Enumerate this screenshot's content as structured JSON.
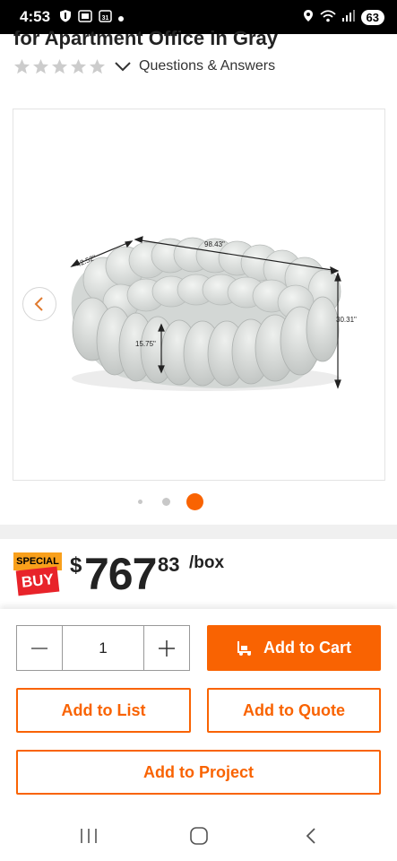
{
  "status_bar": {
    "time": "4:53",
    "battery": "63",
    "network": "6"
  },
  "product": {
    "title_fragment": "for Apartment Office in Gray",
    "rating_stars": 0,
    "questions_link": "Questions & Answers"
  },
  "gallery": {
    "dimensions": {
      "width": "98.43\"",
      "depth": "42.52\"",
      "height": "30.31\"",
      "seat_height": "15.75\""
    },
    "active_dot": 3,
    "dot_count": 3
  },
  "price": {
    "badge_top": "SPECIAL",
    "badge_bottom": "BUY",
    "currency": "$",
    "dollars": "767",
    "cents": "83",
    "unit": "/box"
  },
  "purchase": {
    "quantity": "1",
    "add_to_cart": "Add to Cart",
    "add_to_list": "Add to List",
    "add_to_quote": "Add to Quote",
    "add_to_project": "Add to Project"
  },
  "colors": {
    "accent": "#f96302",
    "badge_yellow": "#f9a01b",
    "badge_red": "#e8232a"
  },
  "icons": [
    "shield-icon",
    "screen-cast-icon",
    "calendar-icon",
    "location-icon",
    "wifi-icon",
    "signal-icon",
    "chevron-down-icon",
    "chevron-left-icon",
    "forklift-icon",
    "recent-apps-icon",
    "home-icon",
    "back-icon"
  ]
}
